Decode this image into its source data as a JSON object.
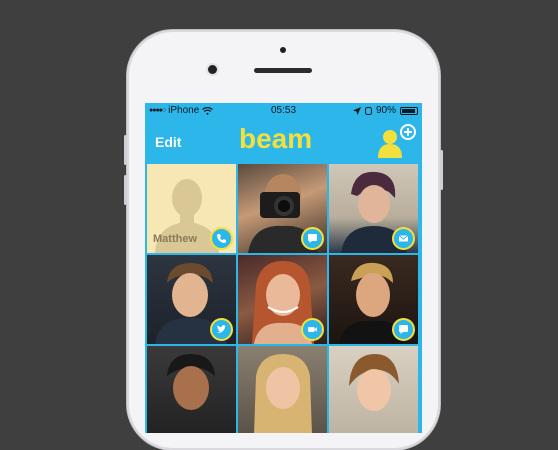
{
  "status_bar": {
    "carrier": "iPhone",
    "time": "05:53",
    "battery": "90%"
  },
  "nav": {
    "edit_label": "Edit",
    "logo_text": "beam"
  },
  "colors": {
    "accent_blue": "#2cb6ea",
    "brand_yellow": "#f4e03c",
    "background": "#3f3f3f"
  },
  "contacts": [
    {
      "name": "Matthew",
      "badge_icon": "phone-icon"
    },
    {
      "name": "",
      "badge_icon": "chat-icon"
    },
    {
      "name": "",
      "badge_icon": "mail-icon"
    },
    {
      "name": "",
      "badge_icon": "twitter-icon"
    },
    {
      "name": "",
      "badge_icon": "video-icon"
    },
    {
      "name": "",
      "badge_icon": "chat-icon"
    },
    {
      "name": "",
      "badge_icon": ""
    },
    {
      "name": "",
      "badge_icon": ""
    },
    {
      "name": "",
      "badge_icon": ""
    }
  ]
}
